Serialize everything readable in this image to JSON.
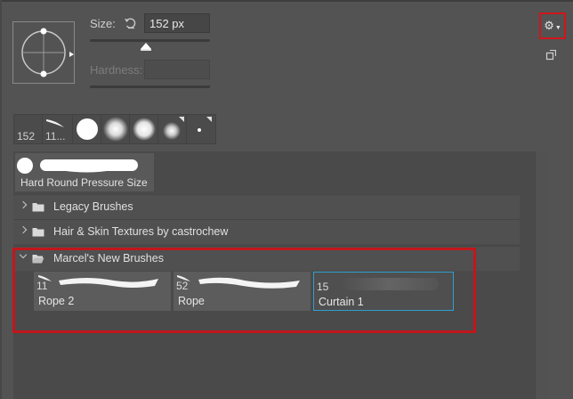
{
  "brush_settings": {
    "size_label": "Size:",
    "size_value": "152 px",
    "size_slider_fraction": 0.47,
    "hardness_label": "Hardness:",
    "hardness_value": ""
  },
  "recent_brushes": [
    {
      "size": "152",
      "icon": "diagonal-stroke"
    },
    {
      "size": "11...",
      "icon": "feather-stroke"
    },
    {
      "size": "",
      "icon": "hard-round"
    },
    {
      "size": "",
      "icon": "soft-round"
    },
    {
      "size": "",
      "icon": "soft-round"
    },
    {
      "size": "",
      "icon": "soft-round-small"
    },
    {
      "size": "",
      "icon": "tiny-dot"
    }
  ],
  "brush_list": {
    "top_preset": {
      "name": "Hard Round Pressure Size"
    },
    "folders": [
      {
        "name": "Legacy Brushes",
        "expanded": false
      },
      {
        "name": "Hair & Skin Textures by castrochew",
        "expanded": false
      },
      {
        "name": "Marcel's New Brushes",
        "expanded": true
      }
    ],
    "expanded_brushes": [
      {
        "size": "11",
        "name": "Rope 2",
        "selected": false
      },
      {
        "size": "52",
        "name": "Rope",
        "selected": false
      },
      {
        "size": "15",
        "name": "Curtain 1",
        "selected": true
      }
    ]
  },
  "colors": {
    "panel_bg": "#535353",
    "highlight": "#c1171c",
    "selection": "#2f9fd0"
  }
}
